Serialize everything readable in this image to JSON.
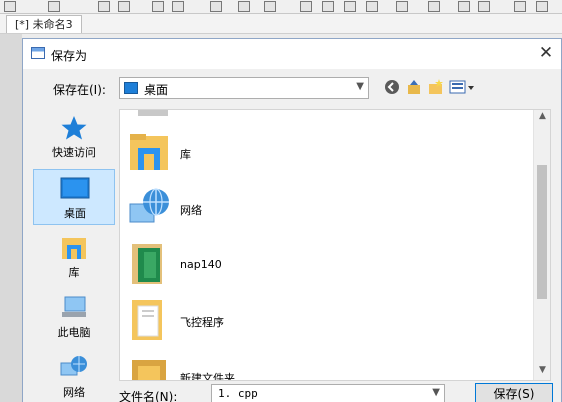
{
  "doc_tab": "[*] 未命名3",
  "dialog": {
    "title": "保存为",
    "close_glyph": "✕",
    "save_in_label": "保存在(I):",
    "save_in_value": "桌面",
    "places": [
      {
        "label": "快速访问",
        "icon": "star-icon"
      },
      {
        "label": "桌面",
        "icon": "desktop-icon"
      },
      {
        "label": "库",
        "icon": "library-icon"
      },
      {
        "label": "此电脑",
        "icon": "computer-icon"
      },
      {
        "label": "网络",
        "icon": "network-icon"
      }
    ],
    "files": [
      {
        "label": "库",
        "icon": "library-icon"
      },
      {
        "label": "网络",
        "icon": "network-icon"
      },
      {
        "label": "nap140",
        "icon": "green-folder-icon"
      },
      {
        "label": "飞控程序",
        "icon": "folder-icon"
      },
      {
        "label": "新建文件夹",
        "icon": "folder-icon"
      }
    ],
    "filename_label": "文件名(N):",
    "filename_value": "1. cpp",
    "save_button": "保存(S)"
  },
  "colors": {
    "accent": "#0078d7",
    "selected_bg": "#cde8ff",
    "folder_yellow": "#f4c55c"
  }
}
